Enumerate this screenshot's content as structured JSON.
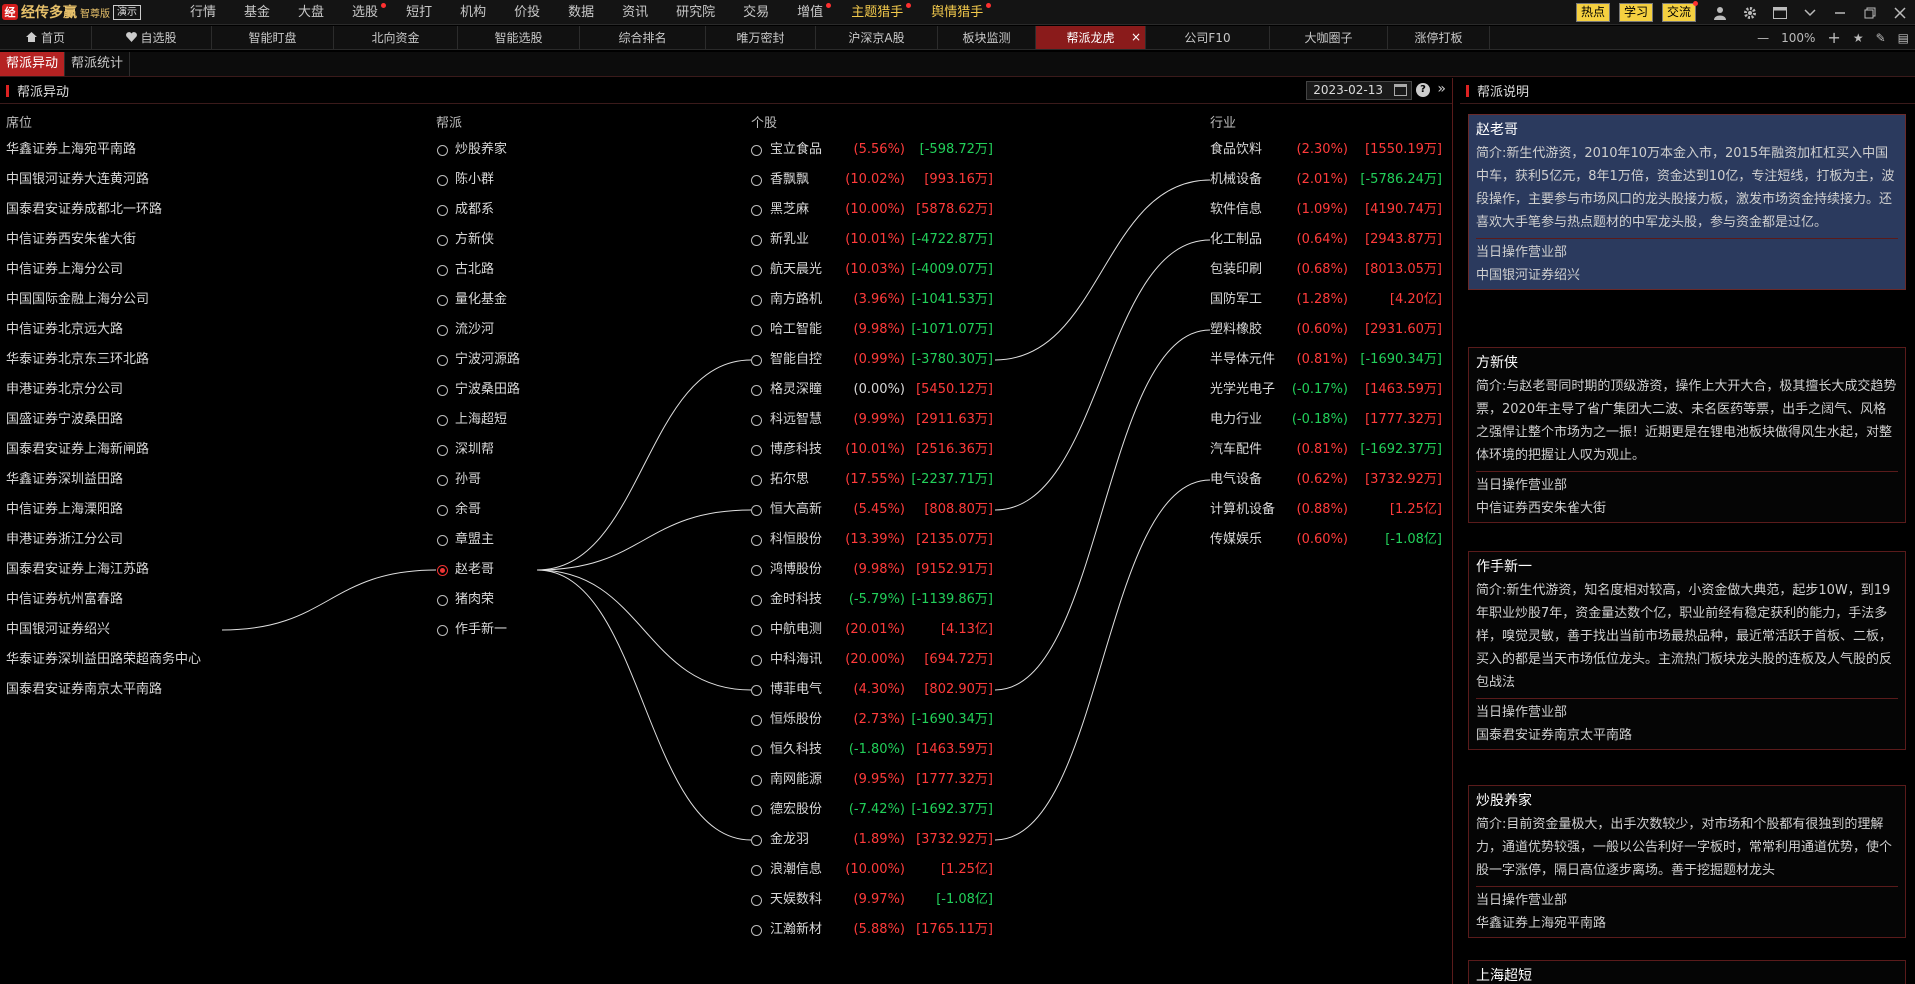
{
  "app": {
    "logo_mark": "经",
    "name": "经传多赢",
    "edition": "智尊版",
    "demo": "演示"
  },
  "menu": [
    {
      "label": "行情"
    },
    {
      "label": "基金"
    },
    {
      "label": "大盘"
    },
    {
      "label": "选股",
      "dot": true
    },
    {
      "label": "短打"
    },
    {
      "label": "机构"
    },
    {
      "label": "价投"
    },
    {
      "label": "数据"
    },
    {
      "label": "资讯"
    },
    {
      "label": "研究院"
    },
    {
      "label": "交易"
    },
    {
      "label": "增值",
      "dot": true
    },
    {
      "label": "主题猎手",
      "dot": true,
      "hl": true
    },
    {
      "label": "舆情猎手",
      "dot": true,
      "hl": true
    }
  ],
  "top_buttons": [
    {
      "label": "热点"
    },
    {
      "label": "学习"
    },
    {
      "label": "交流",
      "dot": true
    }
  ],
  "top_icons": [
    "user-icon",
    "settings-icon",
    "window-icon",
    "chevron-down-icon",
    "minimize-icon",
    "restore-icon",
    "close-icon"
  ],
  "tabs": [
    {
      "label": "首页",
      "icon": "home-icon"
    },
    {
      "label": "自选股",
      "icon": "heart-icon"
    },
    {
      "label": "智能盯盘"
    },
    {
      "label": "北向资金"
    },
    {
      "label": "智能选股"
    },
    {
      "label": "综合排名"
    },
    {
      "label": "唯万密封"
    },
    {
      "label": "沪深京A股"
    },
    {
      "label": "板块监测"
    },
    {
      "label": "帮派龙虎",
      "active": true
    },
    {
      "label": "公司F10"
    },
    {
      "label": "大咖圈子"
    },
    {
      "label": "涨停打板"
    }
  ],
  "zoom": {
    "minus": "—",
    "value": "100%",
    "plus": "+"
  },
  "subtabs": [
    {
      "label": "帮派异动",
      "active": true
    },
    {
      "label": "帮派统计"
    }
  ],
  "left_panel": {
    "title": "帮派异动",
    "date": "2023-02-13",
    "help": "?",
    "collapse": "»"
  },
  "right_panel": {
    "title": "帮派说明"
  },
  "columns": {
    "seat": "席位",
    "gang": "帮派",
    "stock": "个股",
    "industry": "行业"
  },
  "seats": [
    "华鑫证券上海宛平南路",
    "中国银河证券大连黄河路",
    "国泰君安证券成都北一环路",
    "中信证券西安朱雀大街",
    "中信证券上海分公司",
    "中国国际金融上海分公司",
    "中信证券北京远大路",
    "华泰证券北京东三环北路",
    "申港证券北京分公司",
    "国盛证券宁波桑田路",
    "国泰君安证券上海新闸路",
    "华鑫证券深圳益田路",
    "中信证券上海溧阳路",
    "申港证券浙江分公司",
    "国泰君安证券上海江苏路",
    "中信证券杭州富春路",
    "中国银河证券绍兴",
    "华泰证券深圳益田路荣超商务中心",
    "国泰君安证券南京太平南路"
  ],
  "gangs": [
    {
      "name": "炒股养家"
    },
    {
      "name": "陈小群"
    },
    {
      "name": "成都系"
    },
    {
      "name": "方新侠"
    },
    {
      "name": "古北路"
    },
    {
      "name": "量化基金"
    },
    {
      "name": "流沙河"
    },
    {
      "name": "宁波河源路"
    },
    {
      "name": "宁波桑田路"
    },
    {
      "name": "上海超短"
    },
    {
      "name": "深圳帮"
    },
    {
      "name": "孙哥"
    },
    {
      "name": "余哥"
    },
    {
      "name": "章盟主"
    },
    {
      "name": "赵老哥",
      "selected": true
    },
    {
      "name": "猪肉荣"
    },
    {
      "name": "作手新一"
    }
  ],
  "stocks": [
    {
      "name": "宝立食品",
      "pct": "(5.56%)",
      "flow": "[-598.72万]",
      "pc": "red",
      "fc": "green"
    },
    {
      "name": "香飘飘",
      "pct": "(10.02%)",
      "flow": "[993.16万]",
      "pc": "red",
      "fc": "red"
    },
    {
      "name": "黑芝麻",
      "pct": "(10.00%)",
      "flow": "[5878.62万]",
      "pc": "red",
      "fc": "red"
    },
    {
      "name": "新乳业",
      "pct": "(10.01%)",
      "flow": "[-4722.87万]",
      "pc": "red",
      "fc": "green"
    },
    {
      "name": "航天晨光",
      "pct": "(10.03%)",
      "flow": "[-4009.07万]",
      "pc": "red",
      "fc": "green"
    },
    {
      "name": "南方路机",
      "pct": "(3.96%)",
      "flow": "[-1041.53万]",
      "pc": "red",
      "fc": "green"
    },
    {
      "name": "哈工智能",
      "pct": "(9.98%)",
      "flow": "[-1071.07万]",
      "pc": "red",
      "fc": "green"
    },
    {
      "name": "智能自控",
      "pct": "(0.99%)",
      "flow": "[-3780.30万]",
      "pc": "red",
      "fc": "green"
    },
    {
      "name": "格灵深瞳",
      "pct": "(0.00%)",
      "flow": "[5450.12万]",
      "pc": "white",
      "fc": "red"
    },
    {
      "name": "科远智慧",
      "pct": "(9.99%)",
      "flow": "[2911.63万]",
      "pc": "red",
      "fc": "red"
    },
    {
      "name": "博彦科技",
      "pct": "(10.01%)",
      "flow": "[2516.36万]",
      "pc": "red",
      "fc": "red"
    },
    {
      "name": "拓尔思",
      "pct": "(17.55%)",
      "flow": "[-2237.71万]",
      "pc": "red",
      "fc": "green"
    },
    {
      "name": "恒大高新",
      "pct": "(5.45%)",
      "flow": "[808.80万]",
      "pc": "red",
      "fc": "red"
    },
    {
      "name": "科恒股份",
      "pct": "(13.39%)",
      "flow": "[2135.07万]",
      "pc": "red",
      "fc": "red"
    },
    {
      "name": "鸿博股份",
      "pct": "(9.98%)",
      "flow": "[9152.91万]",
      "pc": "red",
      "fc": "red"
    },
    {
      "name": "金时科技",
      "pct": "(-5.79%)",
      "flow": "[-1139.86万]",
      "pc": "green",
      "fc": "green"
    },
    {
      "name": "中航电测",
      "pct": "(20.01%)",
      "flow": "[4.13亿]",
      "pc": "red",
      "fc": "red"
    },
    {
      "name": "中科海讯",
      "pct": "(20.00%)",
      "flow": "[694.72万]",
      "pc": "red",
      "fc": "red"
    },
    {
      "name": "博菲电气",
      "pct": "(4.30%)",
      "flow": "[802.90万]",
      "pc": "red",
      "fc": "red"
    },
    {
      "name": "恒烁股份",
      "pct": "(2.73%)",
      "flow": "[-1690.34万]",
      "pc": "red",
      "fc": "green"
    },
    {
      "name": "恒久科技",
      "pct": "(-1.80%)",
      "flow": "[1463.59万]",
      "pc": "green",
      "fc": "red"
    },
    {
      "name": "南网能源",
      "pct": "(9.95%)",
      "flow": "[1777.32万]",
      "pc": "red",
      "fc": "red"
    },
    {
      "name": "德宏股份",
      "pct": "(-7.42%)",
      "flow": "[-1692.37万]",
      "pc": "green",
      "fc": "green"
    },
    {
      "name": "金龙羽",
      "pct": "(1.89%)",
      "flow": "[3732.92万]",
      "pc": "red",
      "fc": "red"
    },
    {
      "name": "浪潮信息",
      "pct": "(10.00%)",
      "flow": "[1.25亿]",
      "pc": "red",
      "fc": "red"
    },
    {
      "name": "天娱数科",
      "pct": "(9.97%)",
      "flow": "[-1.08亿]",
      "pc": "red",
      "fc": "green"
    },
    {
      "name": "江瀚新材",
      "pct": "(5.88%)",
      "flow": "[1765.11万]",
      "pc": "red",
      "fc": "red"
    }
  ],
  "industries": [
    {
      "name": "食品饮料",
      "pct": "(2.30%)",
      "flow": "[1550.19万]",
      "pc": "red",
      "fc": "red"
    },
    {
      "name": "机械设备",
      "pct": "(2.01%)",
      "flow": "[-5786.24万]",
      "pc": "red",
      "fc": "green"
    },
    {
      "name": "软件信息",
      "pct": "(1.09%)",
      "flow": "[4190.74万]",
      "pc": "red",
      "fc": "red"
    },
    {
      "name": "化工制品",
      "pct": "(0.64%)",
      "flow": "[2943.87万]",
      "pc": "red",
      "fc": "red"
    },
    {
      "name": "包装印刷",
      "pct": "(0.68%)",
      "flow": "[8013.05万]",
      "pc": "red",
      "fc": "red"
    },
    {
      "name": "国防军工",
      "pct": "(1.28%)",
      "flow": "[4.20亿]",
      "pc": "red",
      "fc": "red"
    },
    {
      "name": "塑料橡胶",
      "pct": "(0.60%)",
      "flow": "[2931.60万]",
      "pc": "red",
      "fc": "red"
    },
    {
      "name": "半导体元件",
      "pct": "(0.81%)",
      "flow": "[-1690.34万]",
      "pc": "red",
      "fc": "green"
    },
    {
      "name": "光学光电子",
      "pct": "(-0.17%)",
      "flow": "[1463.59万]",
      "pc": "green",
      "fc": "red"
    },
    {
      "name": "电力行业",
      "pct": "(-0.18%)",
      "flow": "[1777.32万]",
      "pc": "green",
      "fc": "red"
    },
    {
      "name": "汽车配件",
      "pct": "(0.81%)",
      "flow": "[-1692.37万]",
      "pc": "red",
      "fc": "green"
    },
    {
      "name": "电气设备",
      "pct": "(0.62%)",
      "flow": "[3732.92万]",
      "pc": "red",
      "fc": "red"
    },
    {
      "name": "计算机设备",
      "pct": "(0.88%)",
      "flow": "[1.25亿]",
      "pc": "red",
      "fc": "red"
    },
    {
      "name": "传媒娱乐",
      "pct": "(0.60%)",
      "flow": "[-1.08亿]",
      "pc": "red",
      "fc": "green"
    }
  ],
  "links": {
    "seat_to_gang": [
      [
        16,
        14
      ]
    ],
    "gang_to_stock": [
      [
        14,
        7
      ],
      [
        14,
        12
      ],
      [
        14,
        18
      ],
      [
        14,
        23
      ]
    ],
    "stock_to_industry": [
      [
        7,
        1
      ],
      [
        12,
        3
      ],
      [
        18,
        6
      ],
      [
        23,
        11
      ]
    ]
  },
  "cards": [
    {
      "name": "赵老哥",
      "desc": "简介:新生代游资，2010年10万本金入市，2015年融资加杠杠买入中国中车，获利5亿元，8年1万倍，资金达到10亿，专注短线，打板为主，波段操作，主要参与市场风口的龙头股接力板，激发市场资金持续接力。还喜欢大手笔参与热点题材的中军龙头股，参与资金都是过亿。",
      "op_label": "当日操作营业部",
      "op": "中国银河证券绍兴",
      "selected": true
    },
    {
      "name": "方新侠",
      "desc": "简介:与赵老哥同时期的顶级游资，操作上大开大合，极其擅长大成交趋势票，2020年主导了省广集团大二波、未名医药等票，出手之阔气、风格之强悍让整个市场为之一振！近期更是在锂电池板块做得风生水起，对整体环境的把握让人叹为观止。",
      "op_label": "当日操作营业部",
      "op": "中信证券西安朱雀大街"
    },
    {
      "name": "作手新一",
      "desc": "简介:新生代游资，知名度相对较高，小资金做大典范，起步10W，到19年职业炒股7年，资金量达数个亿，职业前经有稳定获利的能力，手法多样，嗅觉灵敏，善于找出当前市场最热品种，最近常活跃于首板、二板，买入的都是当天市场低位龙头。主流热门板块龙头股的连板及人气股的反包战法",
      "op_label": "当日操作营业部",
      "op": "国泰君安证券南京太平南路"
    },
    {
      "name": "炒股养家",
      "desc": "简介:目前资金量极大，出手次数较少，对市场和个股都有很独到的理解力，通道优势较强，一般以公告利好一字板时，常常利用通道优势，使个股一字涨停，隔日高位逐步离场。善于挖掘题材龙头",
      "op_label": "当日操作营业部",
      "op": "华鑫证券上海宛平南路"
    },
    {
      "name": "上海超短",
      "desc": "",
      "op_label": "",
      "op": ""
    }
  ],
  "colors": {
    "accent": "#b52222",
    "up": "#ff3b3b",
    "down": "#22d05a",
    "highlight": "#f2c94c",
    "card_selected": "#2b3a5e"
  }
}
